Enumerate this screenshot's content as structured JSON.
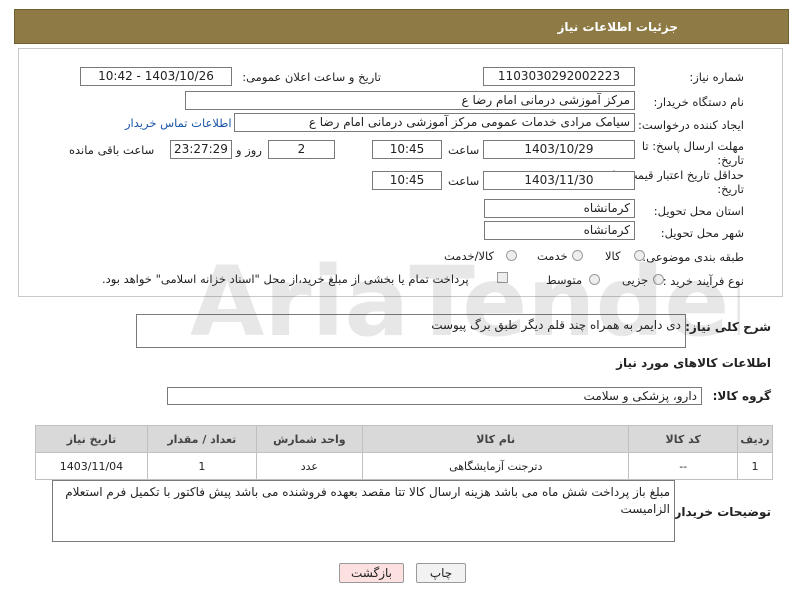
{
  "header": {
    "title": "جزئیات اطلاعات نیاز"
  },
  "form": {
    "need_number_label": "شماره نیاز:",
    "need_number": "1103030292002223",
    "announce_label": "تاریخ و ساعت اعلان عمومی:",
    "announce_value": "1403/10/26 - 10:42",
    "buyer_label": "نام دستگاه خریدار:",
    "buyer_value": "مرکز آموزشی  درمانی امام رضا  ع",
    "creator_label": "ایجاد کننده درخواست:",
    "creator_value": "سیامک مرادی خدمات عمومی مرکز آموزشی  درمانی امام رضا  ع",
    "contact_link": "اطلاعات تماس خریدار",
    "deadline_label_1": "مهلت ارسال پاسخ: تا",
    "deadline_label_2": "تاریخ:",
    "deadline_date": "1403/10/29",
    "time_label": "ساعت",
    "deadline_time": "10:45",
    "days_value": "2",
    "days_label": "روز و",
    "remaining_time": "23:27:29",
    "remaining_label": "ساعت باقی مانده",
    "validity_label_1": "حداقل تاریخ اعتبار قیمت: تا",
    "validity_label_2": "تاریخ:",
    "validity_date": "1403/11/30",
    "validity_time": "10:45",
    "province_label": "استان محل تحویل:",
    "province_value": "کرمانشاه",
    "city_label": "شهر محل تحویل:",
    "city_value": "کرمانشاه",
    "category_label": "طبقه بندی موضوعی:",
    "category_options": [
      "کالا",
      "خدمت",
      "کالا/خدمت"
    ],
    "process_label": "نوع فرآیند خرید :",
    "process_options": [
      "جزیی",
      "متوسط"
    ],
    "payment_note": "پرداخت تمام یا بخشی از مبلغ خرید،از محل \"اسناد خزانه اسلامی\" خواهد بود."
  },
  "description": {
    "label": "شرح کلی نیاز:",
    "value": "دی دایمر به همراه چند قلم دیگر طبق برگ پیوست"
  },
  "goods": {
    "section_title": "اطلاعات کالاهای مورد نیاز",
    "group_label": "گروه کالا:",
    "group_value": "دارو، پزشکی و سلامت",
    "columns": [
      "ردیف",
      "کد کالا",
      "نام کالا",
      "واحد شمارش",
      "تعداد / مقدار",
      "تاریخ نیاز"
    ],
    "rows": [
      [
        "1",
        "--",
        "دترجنت آزمایشگاهی",
        "عدد",
        "1",
        "1403/11/04"
      ]
    ]
  },
  "buyer_notes": {
    "label": "توضیحات خریدار:",
    "value": "مبلغ باز پرداخت شش ماه می باشد هزینه ارسال کالا تتا مقصد بعهده فروشنده می باشد پیش فاکتور با تکمیل فرم استعلام الزامیست"
  },
  "buttons": {
    "print": "چاپ",
    "back": "بازگشت"
  },
  "watermark": {
    "text": "AriaTender.net"
  },
  "colors": {
    "header_bg": "#8d7a44",
    "link": "#1a56a8",
    "back_button_bg": "#fde0e0"
  }
}
